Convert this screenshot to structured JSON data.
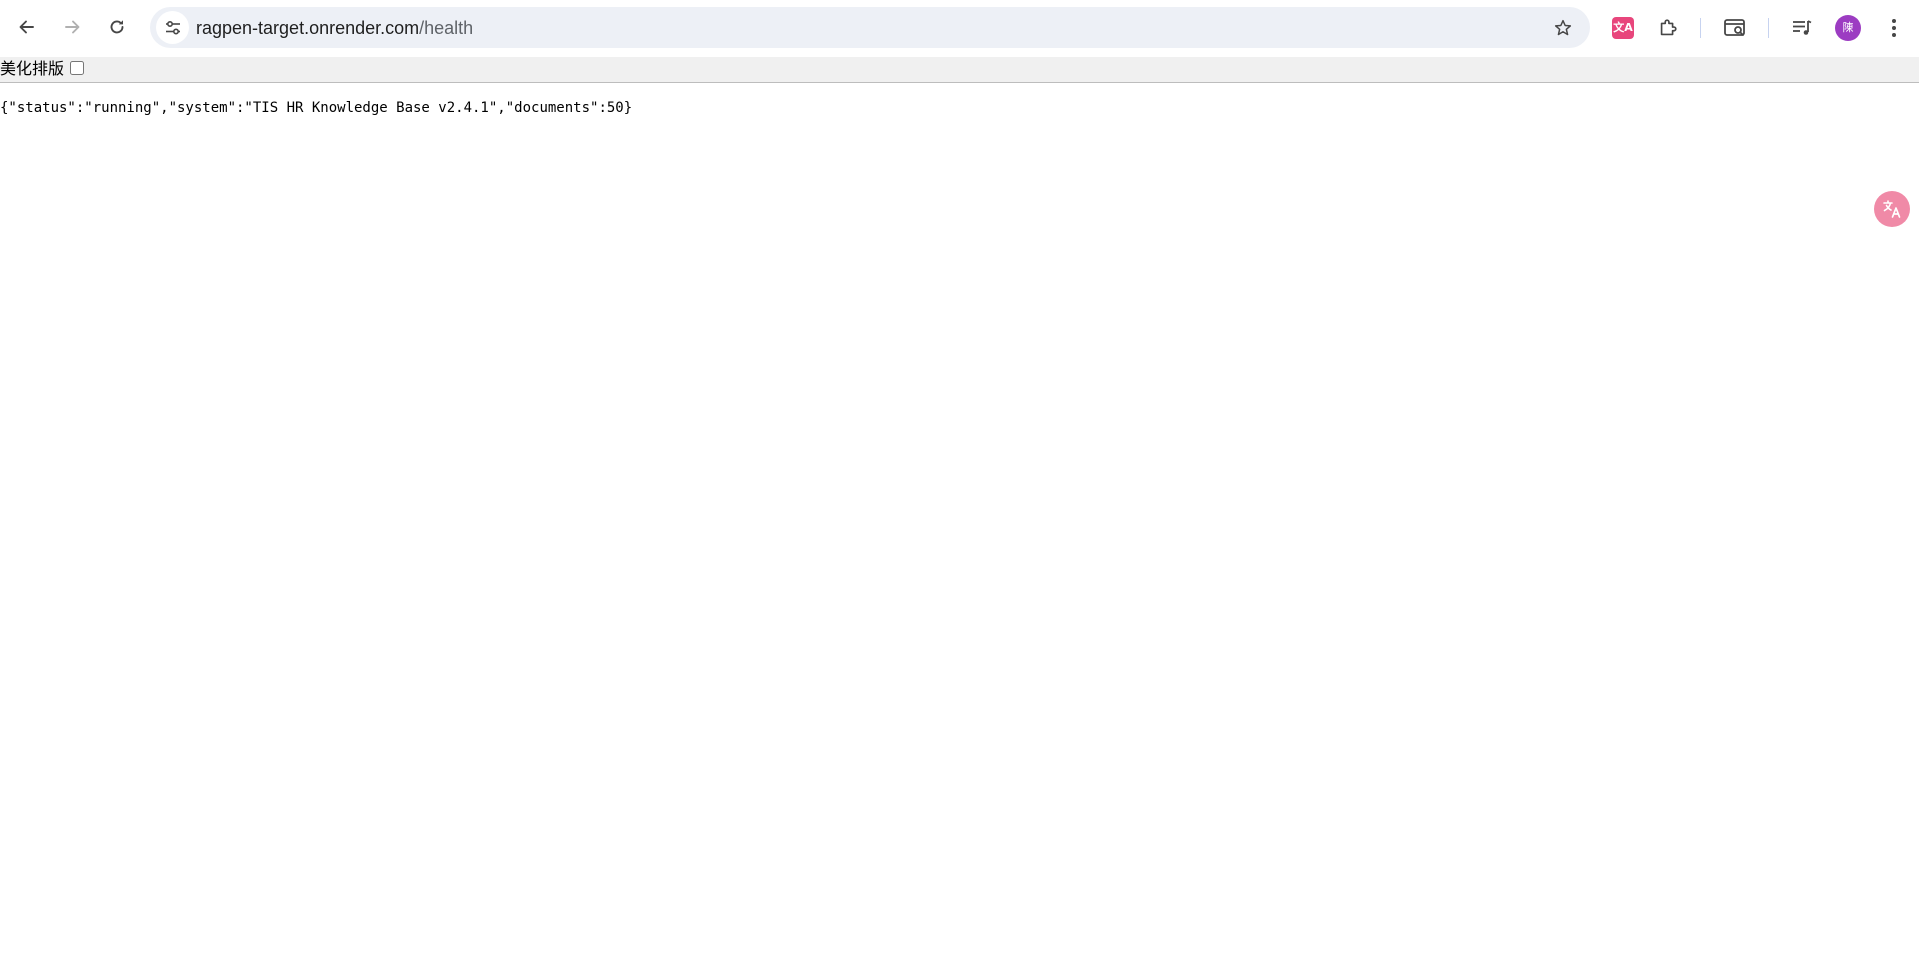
{
  "browser": {
    "url_host": "ragpen-target.onrender.com",
    "url_path": "/health",
    "icons": {
      "back": "arrow-left-icon",
      "forward": "arrow-right-icon",
      "reload": "reload-icon",
      "site_info": "tune-icon",
      "bookmark": "star-icon",
      "extensions": "puzzle-icon",
      "tab_search": "tab-search-icon",
      "reading_list": "reading-list-icon",
      "menu": "kebab-menu-icon"
    },
    "translate_ext_label": "文A",
    "profile_initial": "陳",
    "colors": {
      "avatar": "#9c3cc2",
      "translate_ext": "#e8467c",
      "omnibox_bg": "#edf0f6"
    }
  },
  "page": {
    "pretty_print_label": "美化排版",
    "pretty_print_checked": false,
    "json_text": "{\"status\":\"running\",\"system\":\"TIS HR Knowledge Base v2.4.1\",\"documents\":50}",
    "floating_translate_icon": "translate-icon"
  }
}
